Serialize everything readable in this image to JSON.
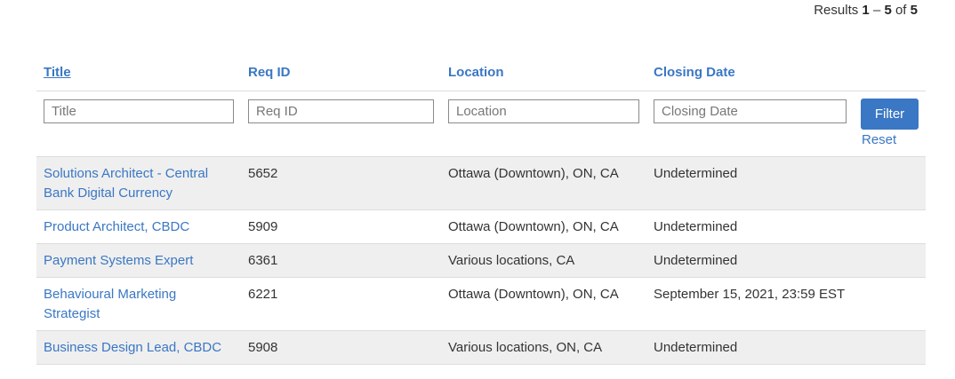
{
  "results": {
    "prefix": "Results",
    "start": "1",
    "dash": "–",
    "end": "5",
    "of": "of",
    "total": "5"
  },
  "columns": [
    {
      "label": "Title"
    },
    {
      "label": "Req ID"
    },
    {
      "label": "Location"
    },
    {
      "label": "Closing Date"
    }
  ],
  "filters": {
    "title_placeholder": "Title",
    "reqid_placeholder": "Req ID",
    "location_placeholder": "Location",
    "closing_placeholder": "Closing Date",
    "filter_label": "Filter",
    "reset_label": "Reset"
  },
  "rows": [
    {
      "title": "Solutions Architect - Central Bank Digital Currency",
      "req_id": "5652",
      "location": "Ottawa (Downtown), ON, CA",
      "closing": "Undetermined"
    },
    {
      "title": "Product Architect, CBDC",
      "req_id": "5909",
      "location": "Ottawa (Downtown), ON, CA",
      "closing": "Undetermined"
    },
    {
      "title": "Payment Systems Expert",
      "req_id": "6361",
      "location": "Various locations, CA",
      "closing": "Undetermined"
    },
    {
      "title": "Behavioural Marketing Strategist",
      "req_id": "6221",
      "location": "Ottawa (Downtown), ON, CA",
      "closing": "September 15, 2021, 23:59 EST"
    },
    {
      "title": "Business Design Lead, CBDC",
      "req_id": "5908",
      "location": "Various locations, ON, CA",
      "closing": "Undetermined"
    }
  ],
  "colors": {
    "link": "#3a77c4",
    "row_shade": "#efefef",
    "button": "#3a77c4"
  }
}
